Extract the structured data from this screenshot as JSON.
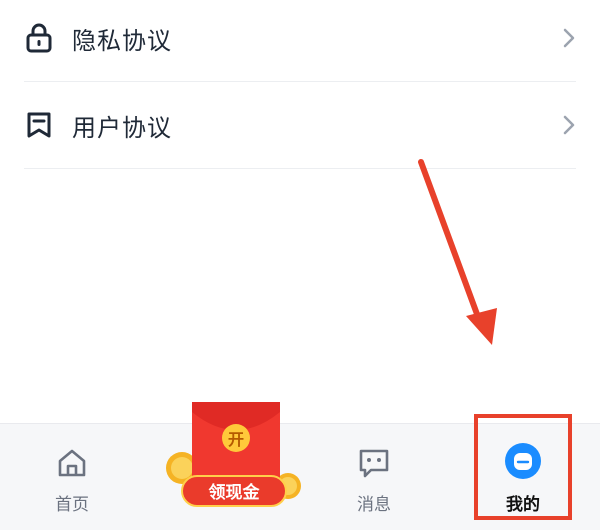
{
  "menu": {
    "items": [
      {
        "label": "隐私协议",
        "icon": "lock-icon"
      },
      {
        "label": "用户协议",
        "icon": "bookmark-icon"
      }
    ]
  },
  "tabbar": {
    "tabs": [
      {
        "label": "首页",
        "icon": "home-icon"
      },
      {
        "label": "领现金",
        "icon": "red-packet-icon",
        "badge": "开"
      },
      {
        "label": "消息",
        "icon": "message-icon"
      },
      {
        "label": "我的",
        "icon": "profile-icon",
        "active": true
      }
    ]
  },
  "colors": {
    "accent_blue": "#1a8cff",
    "highlight_red": "#e8412b",
    "text_dark": "#1f2937",
    "text_gray": "#6b7280"
  }
}
